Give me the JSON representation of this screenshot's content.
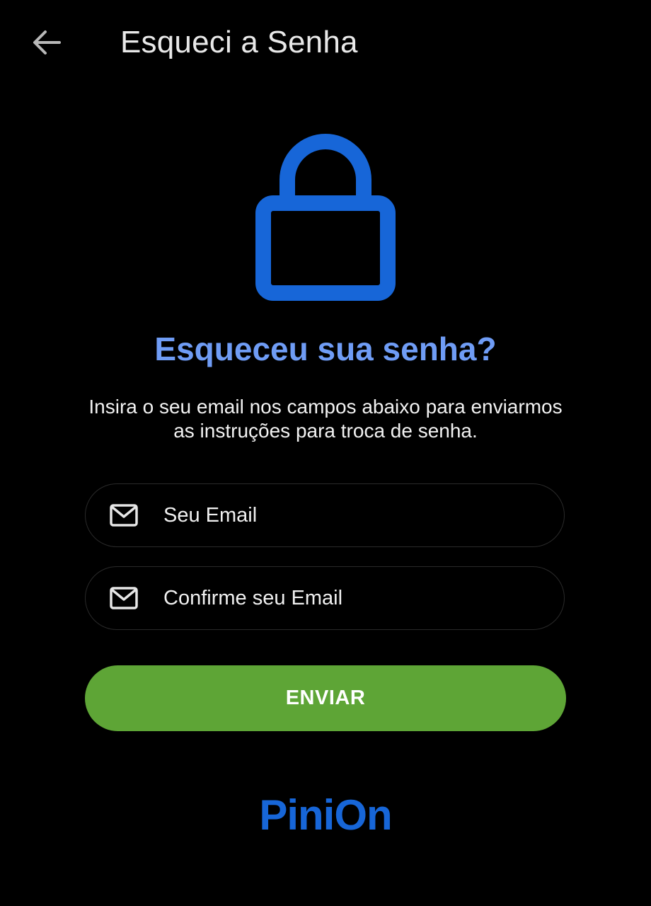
{
  "header": {
    "back_icon": "arrow-left-icon",
    "title": "Esqueci a Senha"
  },
  "hero": {
    "icon": "lock-icon",
    "heading": "Esqueceu sua senha?",
    "description": "Insira o seu email nos campos abaixo para enviarmos as instruções para troca de senha."
  },
  "form": {
    "email": {
      "icon": "mail-icon",
      "value": "",
      "placeholder": "Seu Email"
    },
    "confirm_email": {
      "icon": "mail-icon",
      "value": "",
      "placeholder": "Confirme seu Email"
    },
    "submit_label": "ENVIAR"
  },
  "footer": {
    "brand": "PiniOn"
  },
  "colors": {
    "background": "#000000",
    "accent_blue": "#1766d8",
    "heading_blue": "#6f9cf5",
    "submit_green": "#5ea536",
    "field_border": "#2a2a2a"
  }
}
